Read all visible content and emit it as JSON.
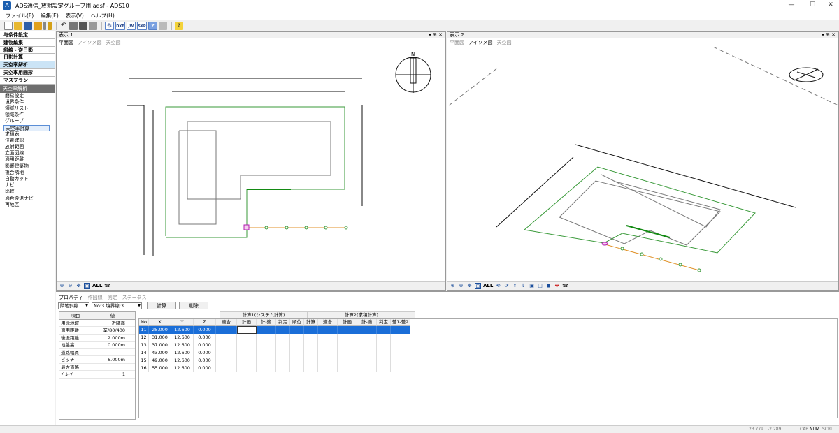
{
  "window": {
    "title": "ADS通信_放射設定グループ用.adsf - ADS10",
    "app_icon": "A"
  },
  "menu": [
    "ファイル(F)",
    "編集(E)",
    "表示(V)",
    "ヘルプ(H)"
  ],
  "toolbar": {
    "format_buttons": [
      "作",
      "DXF",
      "JW",
      "SKP",
      "Z"
    ]
  },
  "left": {
    "groups": [
      "与条件設定",
      "建物編集",
      "斜線・逆日影",
      "日影計算",
      "天空率解析",
      "天空率用図形",
      "マスプラン"
    ],
    "section_title": "天空率解析",
    "items": [
      "簡易設定",
      "境界条件",
      "領域リスト",
      "領域条件",
      "グループ",
      "天空率計算",
      "求積表",
      "位置確認",
      "放射範囲",
      "立面図線",
      "適用距離",
      "影響建築物",
      "複合隣地",
      "自動カット",
      "ナビ",
      "比較",
      "適合後退ナビ",
      "再地区"
    ]
  },
  "view1": {
    "title": "表示 1",
    "controls": "▾ ⊞ ✕",
    "tabs": [
      "平面図",
      "アイソメ図",
      "天空図"
    ],
    "all": "ALL"
  },
  "view2": {
    "title": "表示 2",
    "controls": "▾ ⊞ ✕",
    "tabs": [
      "平面図",
      "アイソメ図",
      "天空図"
    ],
    "all": "ALL"
  },
  "bottom": {
    "tabs": [
      "プロパティ",
      "作図線",
      "測定",
      "ステータス"
    ],
    "combo1": "隣地斜線",
    "combo2": "No:3 境界線:3",
    "calc_button": "計算",
    "delete_button": "削除",
    "prop_headers": [
      "項目",
      "値"
    ],
    "props": [
      {
        "k": "用途地域",
        "v": "近隣商業/80/400"
      },
      {
        "k": "適用距離",
        "v": ""
      },
      {
        "k": "後退距離",
        "v": "2.000m"
      },
      {
        "k": "地盤高",
        "v": "0.000m"
      },
      {
        "k": "道路幅員",
        "v": ""
      },
      {
        "k": "ピッチ",
        "v": "6.000m"
      },
      {
        "k": "最大道路",
        "v": ""
      },
      {
        "k": "ｸﾞﾙｰﾌﾟ",
        "v": "1"
      }
    ],
    "group_headers": [
      "計算1(システム計算)",
      "計算2(求積計算)"
    ],
    "columns": [
      "No",
      "X",
      "Y",
      "Z",
      "適合",
      "計画",
      "計-適",
      "判定",
      "順位",
      "計算",
      "適合",
      "計画",
      "計-適",
      "判定",
      "差1-差2"
    ],
    "rows": [
      [
        "11",
        "25.000",
        "12.600",
        "0.000"
      ],
      [
        "12",
        "31.000",
        "12.600",
        "0.000"
      ],
      [
        "13",
        "37.000",
        "12.600",
        "0.000"
      ],
      [
        "14",
        "43.000",
        "12.600",
        "0.000"
      ],
      [
        "15",
        "49.000",
        "12.600",
        "0.000"
      ],
      [
        "16",
        "55.000",
        "12.600",
        "0.000"
      ]
    ]
  },
  "status": {
    "x": "23.779",
    "y": "-2.289",
    "caps": "CAP",
    "num": "NUM",
    "scrl": "SCRL"
  },
  "colors": {
    "accent": "#0078d7",
    "selection": "#1a6ed8",
    "boundary": "#3a9a3a",
    "measure": "#e0922a"
  }
}
